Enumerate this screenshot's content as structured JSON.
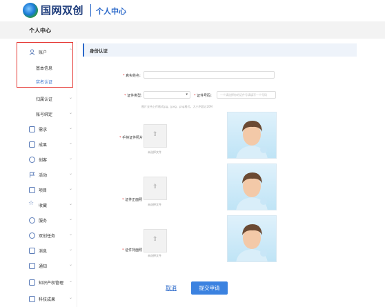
{
  "header": {
    "logo_title": "国网双创",
    "logo_subtitle": "",
    "page_title": "个人中心"
  },
  "breadcrumb": {
    "title": "个人中心"
  },
  "sidebar": {
    "items": [
      {
        "label": "账户",
        "icon": "user-icon"
      },
      {
        "label": "归属认证",
        "icon": ""
      },
      {
        "label": "账号绑定",
        "icon": ""
      },
      {
        "label": "需求",
        "icon": "demand-icon"
      },
      {
        "label": "成果",
        "icon": "achievement-icon"
      },
      {
        "label": "创客",
        "icon": "maker-icon"
      },
      {
        "label": "活动",
        "icon": "flag-icon"
      },
      {
        "label": "项目",
        "icon": "project-icon"
      },
      {
        "label": "收藏",
        "icon": "star-icon"
      },
      {
        "label": "服务",
        "icon": "headset-icon"
      },
      {
        "label": "双创任务",
        "icon": "task-icon"
      },
      {
        "label": "消息",
        "icon": "speaker-icon"
      },
      {
        "label": "通知",
        "icon": "mail-icon"
      },
      {
        "label": "知识产权管理",
        "icon": "ip-icon"
      },
      {
        "label": "科技成果",
        "icon": "tech-icon"
      }
    ],
    "account_sub": [
      {
        "label": "基本信息"
      },
      {
        "label": "实名认证",
        "active": true
      }
    ]
  },
  "main": {
    "section_title": "身份认证",
    "real_name": {
      "label": "真实姓名:",
      "value": "",
      "placeholder": ""
    },
    "cert_type": {
      "label": "证件类型:",
      "value": ""
    },
    "cert_number": {
      "label": "证件号码:",
      "placeholder": "一个请选择你的证件号请填写一个号码"
    },
    "hint": "图片支持上传格式jpg、jpeg、png格式，大小不超过20M",
    "handheld": {
      "label": "手持证件照片",
      "upload_text": "未选择文件"
    },
    "front": {
      "label": "证件正面照",
      "upload_text": "未选择文件"
    },
    "back": {
      "label": "证件背面照",
      "upload_text": "未选择文件"
    }
  },
  "actions": {
    "cancel": "取消",
    "submit": "提交申请"
  },
  "colors": {
    "accent": "#2a68c9",
    "submit_bg": "#3b82e0",
    "highlight": "#e53935"
  }
}
